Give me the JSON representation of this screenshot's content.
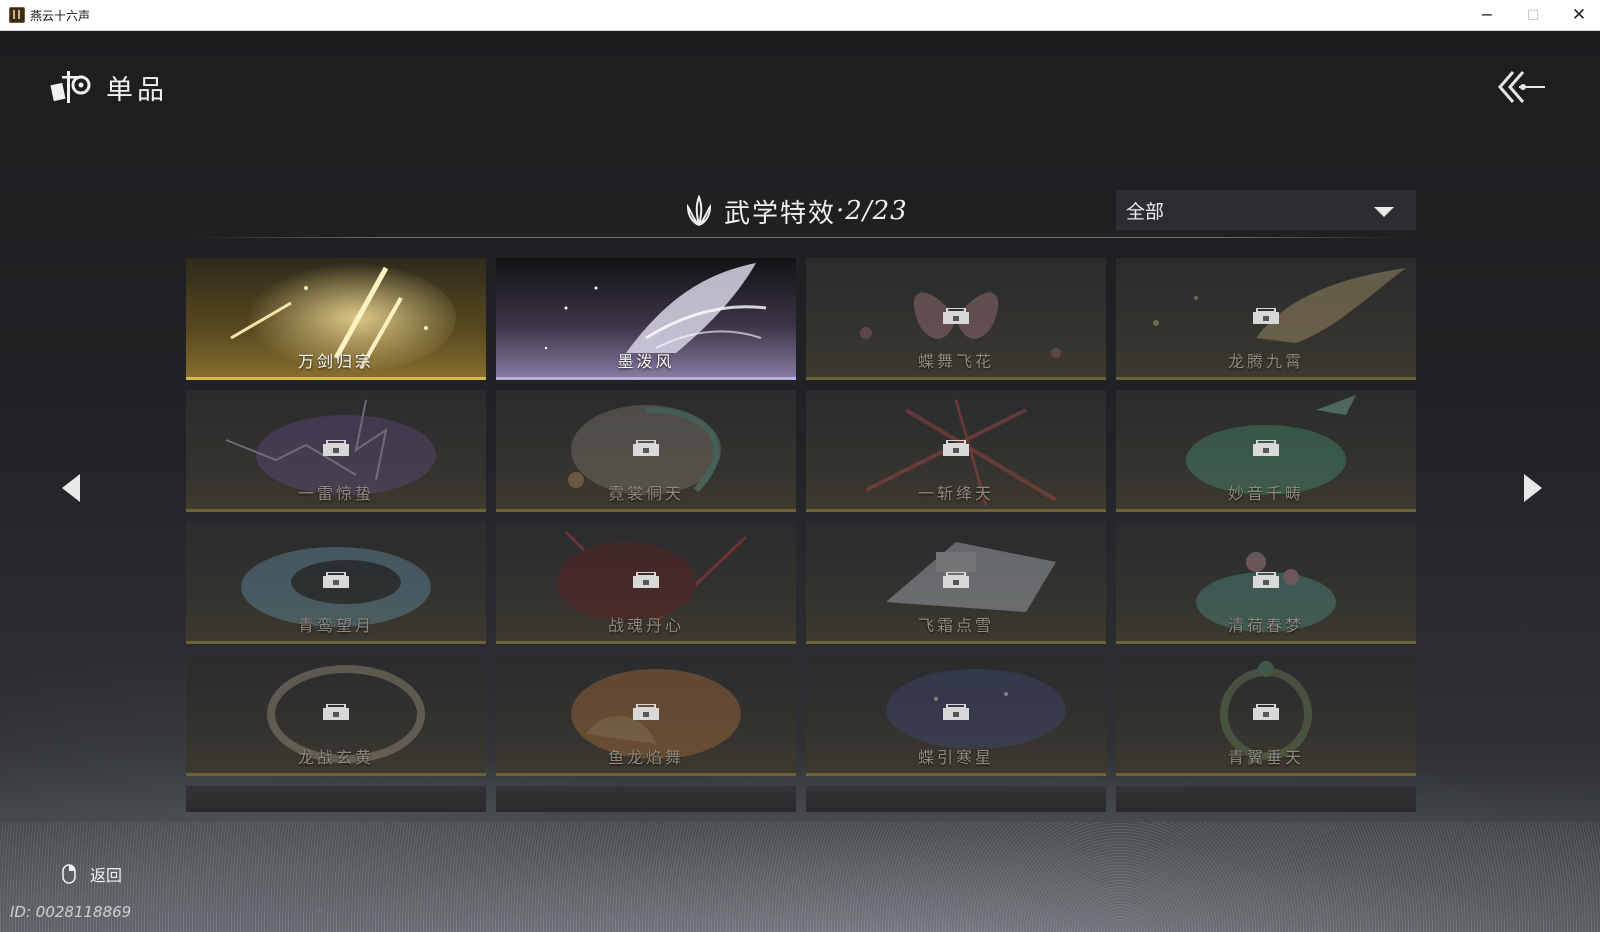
{
  "window": {
    "title": "燕云十六声",
    "minimize": "−",
    "maximize": "□",
    "close": "✕"
  },
  "header": {
    "logo_icon": "ink-brush-logo-icon",
    "title": "单品",
    "back_icon": "double-chevron-back-icon"
  },
  "section": {
    "icon": "lotus-flame-icon",
    "title": "武学特效",
    "count": "·2/23"
  },
  "filter": {
    "value": "全部"
  },
  "navigation": {
    "prev_icon": "triangle-left-icon",
    "next_icon": "triangle-right-icon"
  },
  "items": [
    {
      "name": "万剑归宗",
      "locked": false,
      "theme": "gold"
    },
    {
      "name": "墨泼风",
      "locked": false,
      "theme": "purple"
    },
    {
      "name": "蝶舞飞花",
      "locked": true,
      "theme": "pink"
    },
    {
      "name": "龙腾九霄",
      "locked": true,
      "theme": "amber"
    },
    {
      "name": "一雷惊蛰",
      "locked": true,
      "theme": "violet"
    },
    {
      "name": "霓裳侗天",
      "locked": true,
      "theme": "teal"
    },
    {
      "name": "一斩绛天",
      "locked": true,
      "theme": "red"
    },
    {
      "name": "妙音千畴",
      "locked": true,
      "theme": "green"
    },
    {
      "name": "青鸾望月",
      "locked": true,
      "theme": "blue"
    },
    {
      "name": "战魂丹心",
      "locked": true,
      "theme": "crimson"
    },
    {
      "name": "飞霜点雪",
      "locked": true,
      "theme": "frost"
    },
    {
      "name": "清荷春梦",
      "locked": true,
      "theme": "lotus"
    },
    {
      "name": "龙战玄黄",
      "locked": true,
      "theme": "bronze"
    },
    {
      "name": "鱼龙焰舞",
      "locked": true,
      "theme": "orange"
    },
    {
      "name": "蝶引寒星",
      "locked": true,
      "theme": "starry"
    },
    {
      "name": "青翼垂天",
      "locked": true,
      "theme": "jade"
    }
  ],
  "footer": {
    "mouse_icon": "mouse-right-click-icon",
    "back_label": "返回",
    "player_id": "ID: 0028118869"
  },
  "colors": {
    "unlocked_gold": "#d8b650",
    "unlocked_purple": "#b9aedb",
    "locked_border": "#6e6135",
    "locked_text": "#8e8a80"
  }
}
